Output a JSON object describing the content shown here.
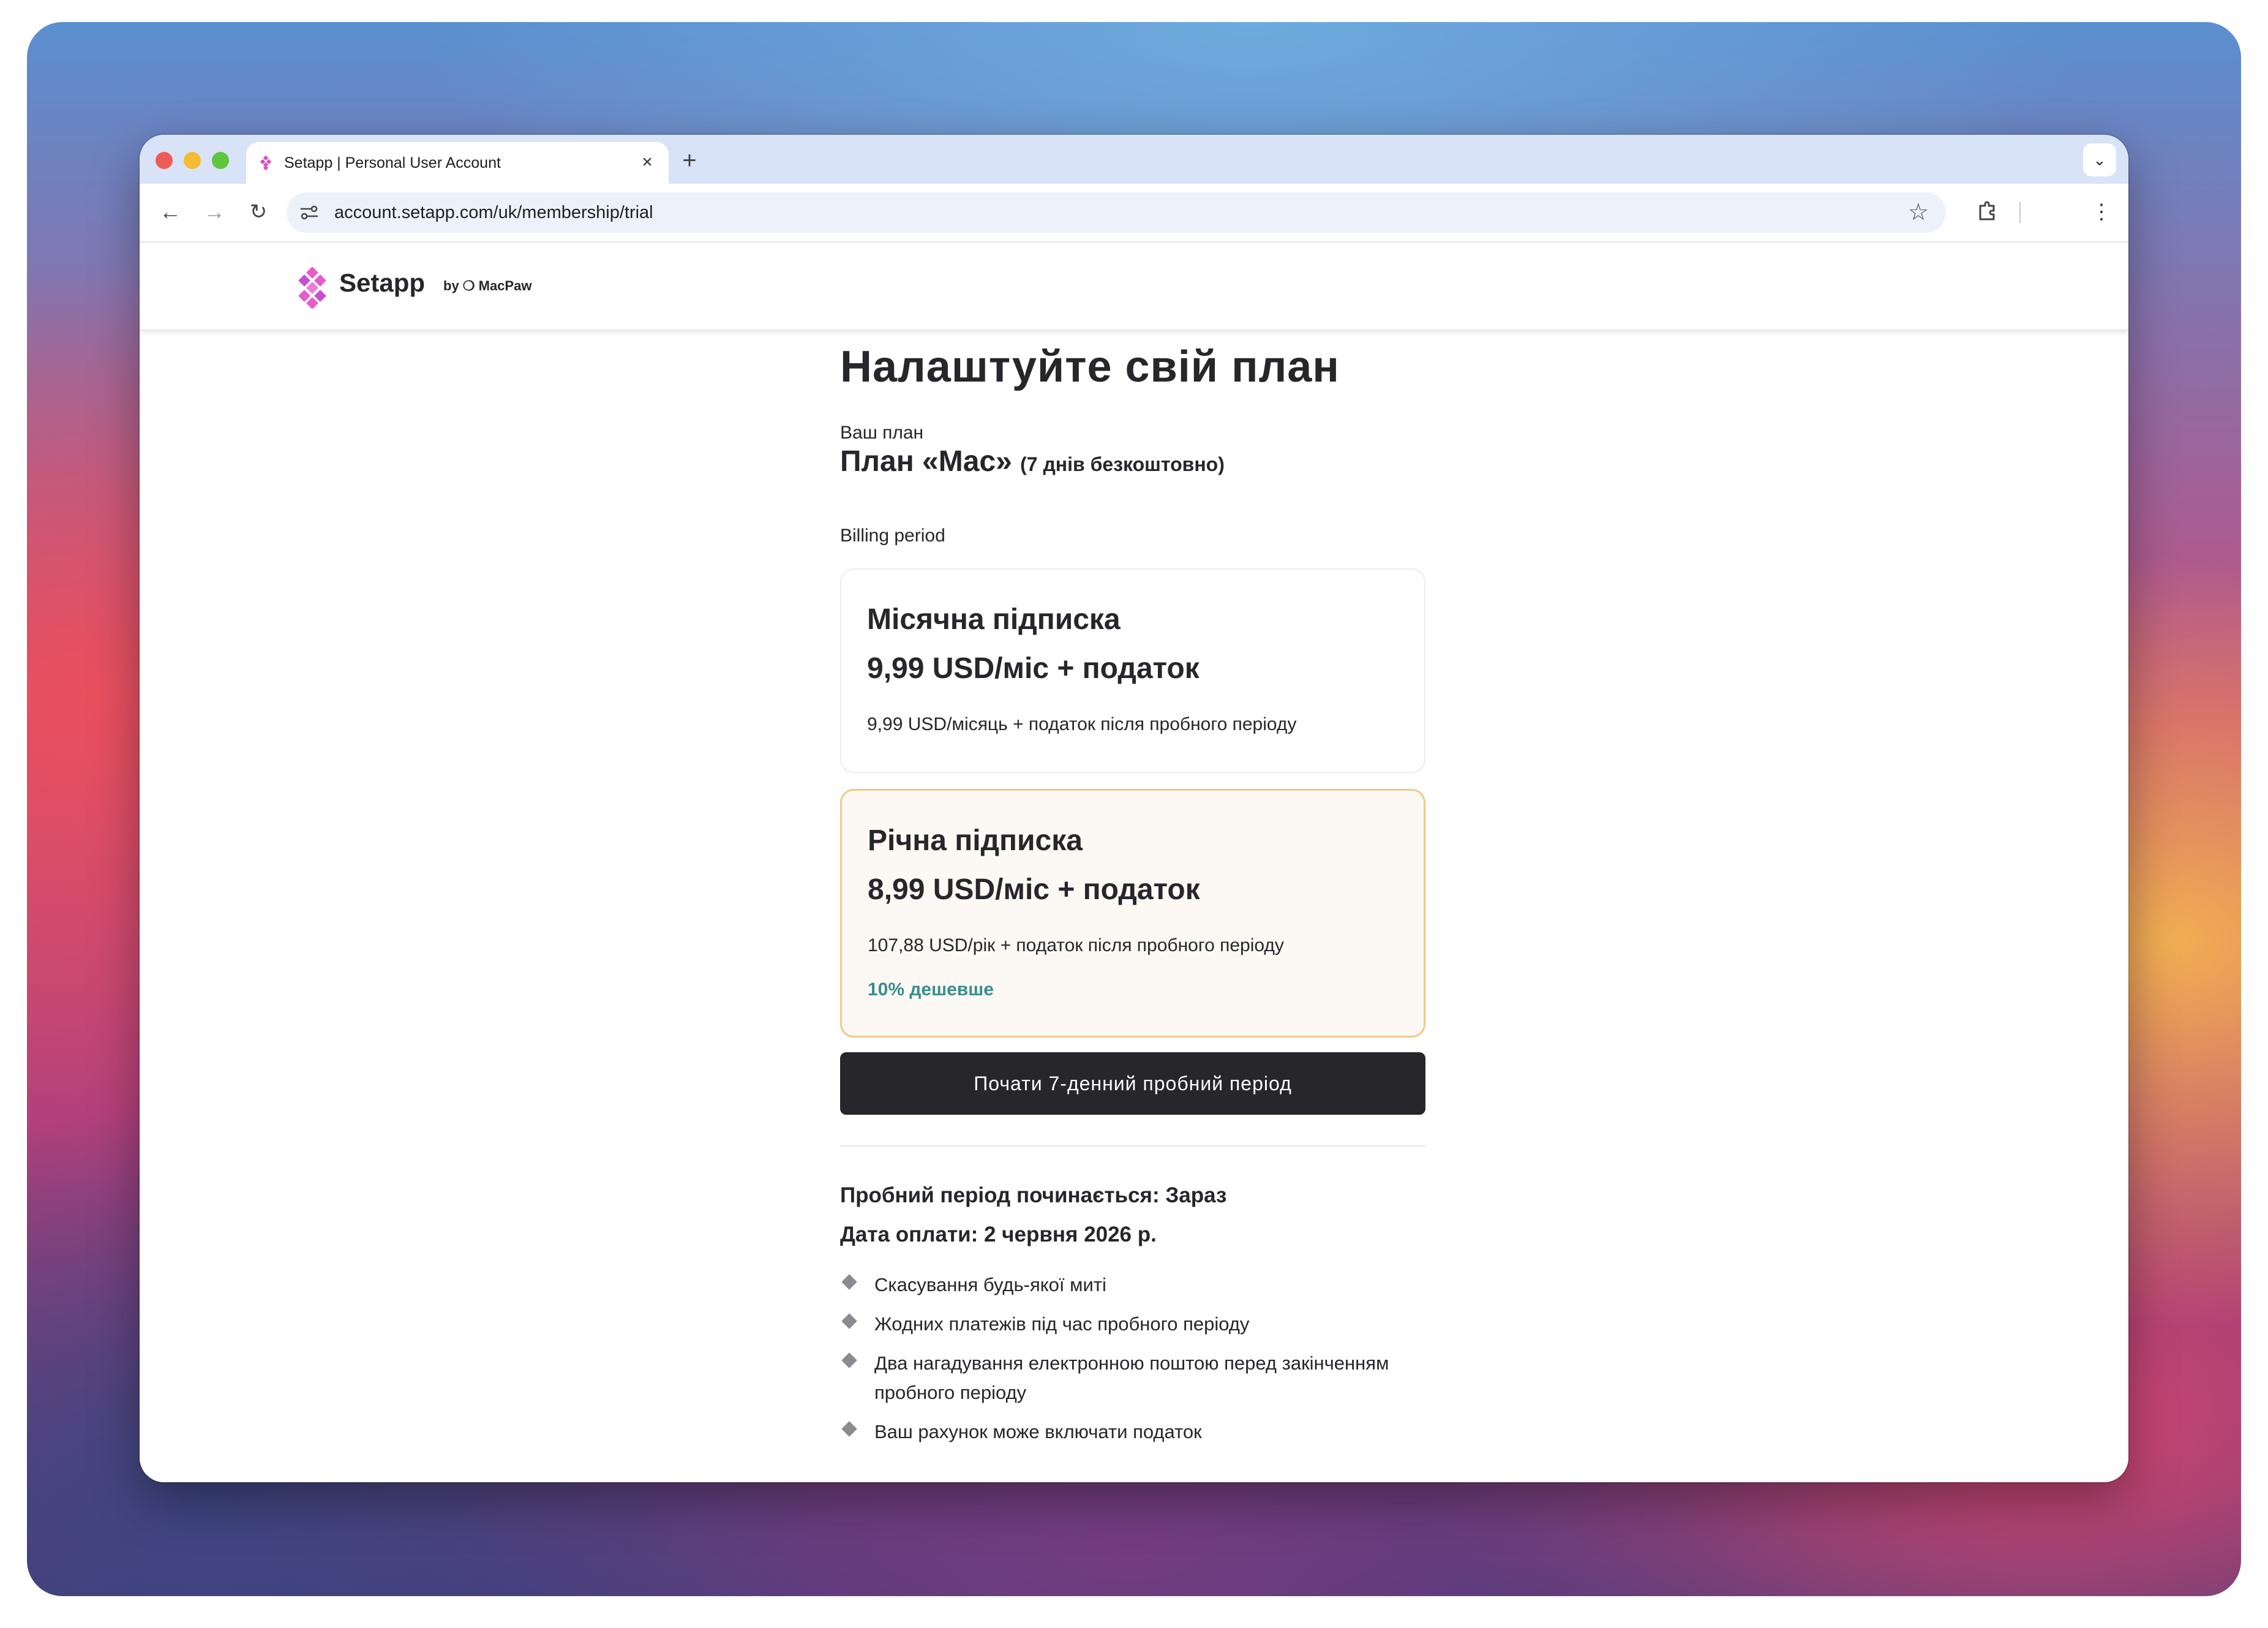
{
  "browser": {
    "tab_title": "Setapp | Personal User Account",
    "url": "account.setapp.com/uk/membership/trial"
  },
  "header": {
    "logo_text": "Setapp",
    "logo_by": "by ❍ MacPaw"
  },
  "main": {
    "title": "Налаштуйте свій план",
    "plan_label": "Ваш план",
    "plan_name": "План «Mac»",
    "plan_trial": "(7 днів безкоштовно)",
    "billing_label": "Billing period",
    "options": [
      {
        "title": "Місячна підписка",
        "price": "9,99 USD/міс + податок",
        "note": "9,99 USD/місяць + податок після пробного періоду",
        "badge": ""
      },
      {
        "title": "Річна підписка",
        "price": "8,99 USD/міс + податок",
        "note": "107,88 USD/рік + податок після пробного періоду",
        "badge": "10% дешевше"
      }
    ],
    "selected_option": "Річна підписка",
    "cta_label": "Почати 7-денний пробний період",
    "trial_start": "Пробний період починається: Зараз",
    "payment_date": "Дата оплати: 2 червня 2026 р.",
    "benefits": [
      "Скасування будь-якої миті",
      "Жодних платежів під час пробного періоду",
      "Два нагадування електронною поштою перед закінченням пробного періоду",
      "Ваш рахунок може включати податок"
    ]
  },
  "colors": {
    "accent_dark": "#26262b",
    "selected_border": "#f0c98a",
    "badge_green": "#3c8c8c",
    "brand_pink": "#e85bc8"
  }
}
